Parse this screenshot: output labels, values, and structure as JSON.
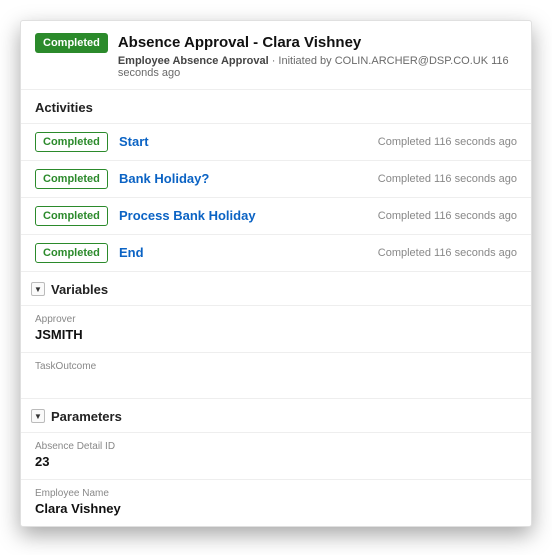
{
  "header": {
    "status_badge": "Completed",
    "title": "Absence Approval - Clara Vishney",
    "subtitle_bold": "Employee Absence Approval",
    "subtitle_separator": " · Initiated by ",
    "initiator": "COLIN.ARCHER@DSP.CO.UK",
    "time_ago": " 116 seconds ago"
  },
  "activities_header": "Activities",
  "activities": [
    {
      "status": "Completed",
      "name": "Start",
      "time": "Completed 116 seconds ago"
    },
    {
      "status": "Completed",
      "name": "Bank Holiday?",
      "time": "Completed 116 seconds ago"
    },
    {
      "status": "Completed",
      "name": "Process Bank Holiday",
      "time": "Completed 116 seconds ago"
    },
    {
      "status": "Completed",
      "name": "End",
      "time": "Completed 116 seconds ago"
    }
  ],
  "variables_header": "Variables",
  "variables": [
    {
      "label": "Approver",
      "value": "JSMITH"
    },
    {
      "label": "TaskOutcome",
      "value": ""
    }
  ],
  "parameters_header": "Parameters",
  "parameters": [
    {
      "label": "Absence Detail ID",
      "value": "23"
    },
    {
      "label": "Employee Name",
      "value": "Clara Vishney"
    }
  ]
}
